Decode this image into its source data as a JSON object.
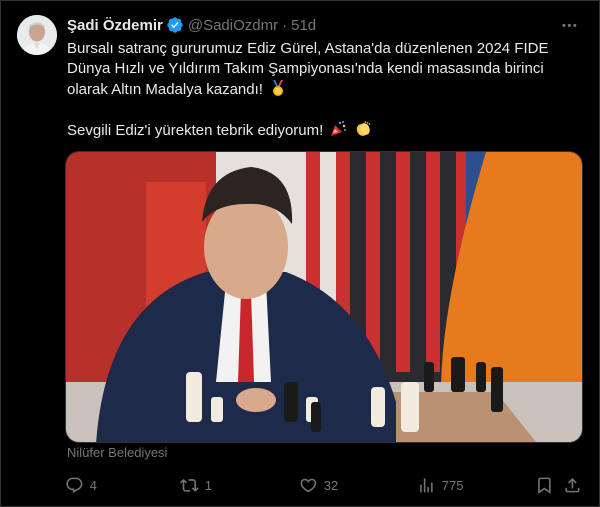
{
  "author": {
    "name": "Şadi Özdemir",
    "handle": "@SadiOzdmr",
    "separator": "·",
    "time": "51d"
  },
  "tweet": {
    "line1": "Bursalı satranç gururumuz Ediz Gürel, Astana'da düzenlenen 2024 FIDE",
    "line2": "Dünya Hızlı ve Yıldırım Takım Şampiyonası'nda kendi masasında birinci",
    "line3": "olarak Altın Madalya kazandı!",
    "line4": "Sevgili Ediz'i yürekten tebrik ediyorum!"
  },
  "media": {
    "caption": "Nilüfer Belediyesi"
  },
  "actions": {
    "replies": "4",
    "reposts": "1",
    "likes": "32",
    "views": "775"
  },
  "icons": {
    "verified": "verified-badge-icon",
    "more": "more-icon",
    "reply": "reply-icon",
    "repost": "repost-icon",
    "like": "like-icon",
    "views": "views-icon",
    "bookmark": "bookmark-icon",
    "share": "share-icon",
    "medal": "medal-emoji",
    "party": "party-popper-emoji",
    "clap": "clapping-hands-emoji"
  },
  "colors": {
    "background": "#000000",
    "text": "#e7e9ea",
    "muted": "#71767b",
    "verified": "#1d9bf0",
    "border": "#2f3336"
  }
}
